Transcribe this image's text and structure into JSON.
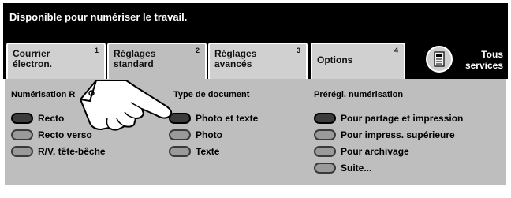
{
  "status": "Disponible pour numériser le travail.",
  "tabs": [
    {
      "label": "Courrier\nélectron.",
      "num": "1"
    },
    {
      "label": "Réglages\nstandard",
      "num": "2"
    },
    {
      "label": "Réglages\navancés",
      "num": "3"
    },
    {
      "label": "Options",
      "num": "4"
    }
  ],
  "tous_services": "Tous\nservices",
  "sections": {
    "numerisation": {
      "title": "Numérisation R",
      "options": [
        "Recto",
        "Recto verso",
        "R/V, tête-bêche"
      ],
      "selected": 0
    },
    "type_document": {
      "title": "Type de document",
      "options": [
        "Photo et texte",
        "Photo",
        "Texte"
      ],
      "selected": 0
    },
    "preregl": {
      "title": "Prérégl. numérisation",
      "options": [
        "Pour partage et impression",
        "Pour impress. supérieure",
        "Pour archivage",
        "Suite..."
      ],
      "selected": 0
    }
  },
  "icons": {
    "tous_services": "copier-machine-icon",
    "pointer": "pointing-hand-icon"
  }
}
